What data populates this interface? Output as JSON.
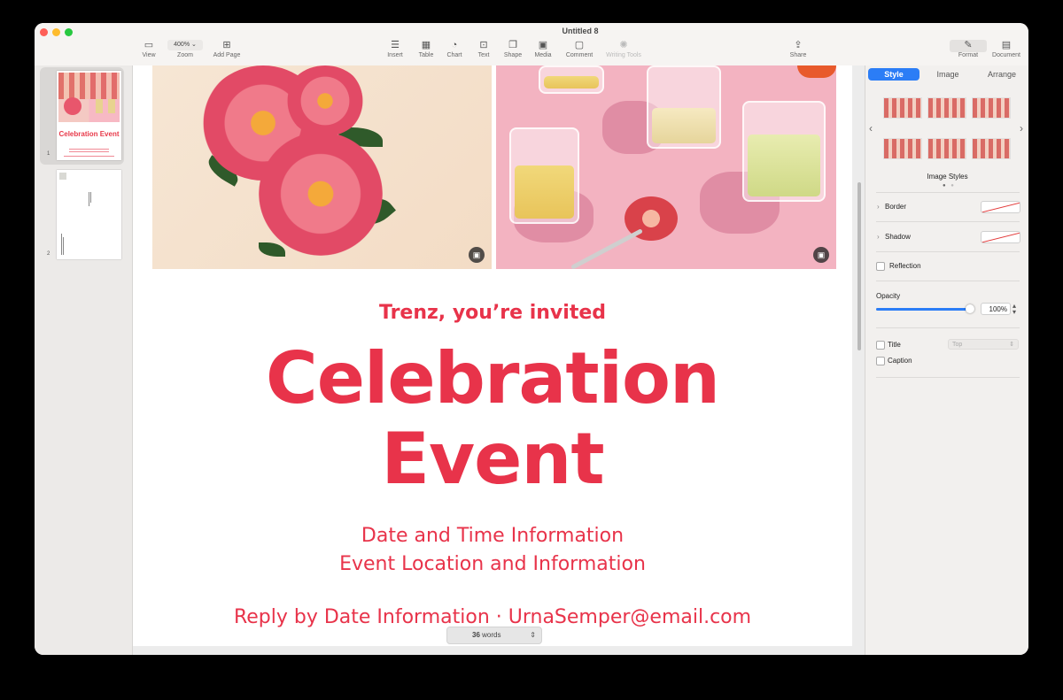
{
  "window": {
    "title": "Untitled 8"
  },
  "toolbar": {
    "view": "View",
    "zoom_value": "400%",
    "zoom": "Zoom",
    "add_page": "Add Page",
    "insert": "Insert",
    "table": "Table",
    "chart": "Chart",
    "text": "Text",
    "shape": "Shape",
    "media": "Media",
    "comment": "Comment",
    "writing_tools": "Writing Tools",
    "share": "Share",
    "format": "Format",
    "document": "Document"
  },
  "thumbnails": {
    "pages": [
      {
        "number": "1"
      },
      {
        "number": "2"
      }
    ],
    "page1_title": "Celebration Event"
  },
  "document": {
    "subtitle": "Trenz, you’re invited",
    "title_line1": "Celebration",
    "title_line2": "Event",
    "line1": "Date and Time Information",
    "line2": "Event Location and Information",
    "line3": "Reply by Date Information · UrnaSemper@email.com"
  },
  "word_count": {
    "count": "36",
    "label": "words"
  },
  "inspector": {
    "tabs": [
      "Style",
      "Image",
      "Arrange"
    ],
    "active_tab": "Style",
    "image_styles_label": "Image Styles",
    "border": "Border",
    "shadow": "Shadow",
    "reflection": "Reflection",
    "opacity_label": "Opacity",
    "opacity_value": "100%",
    "opacity_level": 1.0,
    "title": "Title",
    "title_position": "Top",
    "caption": "Caption"
  },
  "colors": {
    "accent": "#2b7df6",
    "invite_red": "#e8334a"
  },
  "icons": [
    "view-icon",
    "add-page-icon",
    "insert-icon",
    "table-icon",
    "chart-icon",
    "text-icon",
    "shape-icon",
    "media-icon",
    "comment-icon",
    "writing-tools-icon",
    "share-icon",
    "format-icon",
    "document-icon",
    "photo-replace-icon",
    "chevron-left-icon",
    "chevron-right-icon"
  ]
}
